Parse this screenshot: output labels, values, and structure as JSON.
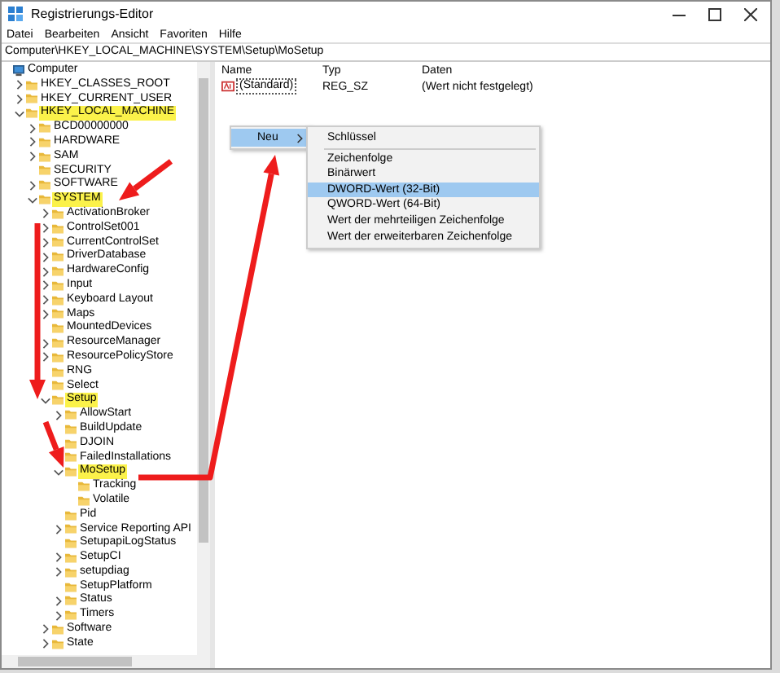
{
  "window": {
    "title": "Registrierungs-Editor"
  },
  "menu_bar": [
    "Datei",
    "Bearbeiten",
    "Ansicht",
    "Favoriten",
    "Hilfe"
  ],
  "address_bar": "Computer\\HKEY_LOCAL_MACHINE\\SYSTEM\\Setup\\MoSetup",
  "tree": [
    {
      "label": "Computer",
      "kind": "computer",
      "highlighted": false,
      "children": [
        {
          "label": "HKEY_CLASSES_ROOT",
          "kind": "folder",
          "highlighted": false,
          "expanded": false
        },
        {
          "label": "HKEY_CURRENT_USER",
          "kind": "folder",
          "highlighted": false,
          "expanded": false
        },
        {
          "label": "HKEY_LOCAL_MACHINE",
          "kind": "folder",
          "highlighted": true,
          "expanded": true,
          "children": [
            {
              "label": "BCD00000000",
              "kind": "folder",
              "highlighted": false,
              "expanded": false
            },
            {
              "label": "HARDWARE",
              "kind": "folder",
              "highlighted": false,
              "expanded": false
            },
            {
              "label": "SAM",
              "kind": "folder",
              "highlighted": false,
              "expanded": false
            },
            {
              "label": "SECURITY",
              "kind": "folder",
              "highlighted": false
            },
            {
              "label": "SOFTWARE",
              "kind": "folder",
              "highlighted": false,
              "expanded": false
            },
            {
              "label": "SYSTEM",
              "kind": "folder",
              "highlighted": true,
              "expanded": true,
              "children": [
                {
                  "label": "ActivationBroker",
                  "kind": "folder",
                  "highlighted": false,
                  "expanded": false
                },
                {
                  "label": "ControlSet001",
                  "kind": "folder",
                  "highlighted": false,
                  "expanded": false
                },
                {
                  "label": "CurrentControlSet",
                  "kind": "folder",
                  "highlighted": false,
                  "expanded": false
                },
                {
                  "label": "DriverDatabase",
                  "kind": "folder",
                  "highlighted": false,
                  "expanded": false
                },
                {
                  "label": "HardwareConfig",
                  "kind": "folder",
                  "highlighted": false,
                  "expanded": false
                },
                {
                  "label": "Input",
                  "kind": "folder",
                  "highlighted": false,
                  "expanded": false
                },
                {
                  "label": "Keyboard Layout",
                  "kind": "folder",
                  "highlighted": false,
                  "expanded": false
                },
                {
                  "label": "Maps",
                  "kind": "folder",
                  "highlighted": false,
                  "expanded": false
                },
                {
                  "label": "MountedDevices",
                  "kind": "folder",
                  "highlighted": false
                },
                {
                  "label": "ResourceManager",
                  "kind": "folder",
                  "highlighted": false,
                  "expanded": false
                },
                {
                  "label": "ResourcePolicyStore",
                  "kind": "folder",
                  "highlighted": false,
                  "expanded": false
                },
                {
                  "label": "RNG",
                  "kind": "folder",
                  "highlighted": false
                },
                {
                  "label": "Select",
                  "kind": "folder",
                  "highlighted": false
                },
                {
                  "label": "Setup",
                  "kind": "folder",
                  "highlighted": true,
                  "expanded": true,
                  "children": [
                    {
                      "label": "AllowStart",
                      "kind": "folder",
                      "highlighted": false,
                      "expanded": false
                    },
                    {
                      "label": "BuildUpdate",
                      "kind": "folder",
                      "highlighted": false
                    },
                    {
                      "label": "DJOIN",
                      "kind": "folder",
                      "highlighted": false
                    },
                    {
                      "label": "FailedInstallations",
                      "kind": "folder",
                      "highlighted": false
                    },
                    {
                      "label": "MoSetup",
                      "kind": "folder",
                      "highlighted": true,
                      "expanded": true,
                      "children": [
                        {
                          "label": "Tracking",
                          "kind": "folder",
                          "highlighted": false
                        },
                        {
                          "label": "Volatile",
                          "kind": "folder",
                          "highlighted": false
                        }
                      ]
                    },
                    {
                      "label": "Pid",
                      "kind": "folder",
                      "highlighted": false
                    },
                    {
                      "label": "Service Reporting API",
                      "kind": "folder",
                      "highlighted": false,
                      "expanded": false
                    },
                    {
                      "label": "SetupapiLogStatus",
                      "kind": "folder",
                      "highlighted": false
                    },
                    {
                      "label": "SetupCI",
                      "kind": "folder",
                      "highlighted": false,
                      "expanded": false
                    },
                    {
                      "label": "setupdiag",
                      "kind": "folder",
                      "highlighted": false,
                      "expanded": false
                    },
                    {
                      "label": "SetupPlatform",
                      "kind": "folder",
                      "highlighted": false
                    },
                    {
                      "label": "Status",
                      "kind": "folder",
                      "highlighted": false,
                      "expanded": false
                    },
                    {
                      "label": "Timers",
                      "kind": "folder",
                      "highlighted": false,
                      "expanded": false
                    }
                  ]
                },
                {
                  "label": "Software",
                  "kind": "folder",
                  "highlighted": false,
                  "expanded": false
                },
                {
                  "label": "State",
                  "kind": "folder",
                  "highlighted": false,
                  "expanded": false
                }
              ]
            }
          ]
        }
      ]
    }
  ],
  "values_table": {
    "columns": [
      "Name",
      "Typ",
      "Daten"
    ],
    "rows": [
      {
        "name": "(Standard)",
        "type": "REG_SZ",
        "data": "(Wert nicht festgelegt)"
      }
    ]
  },
  "context_menu": {
    "items": [
      {
        "label": "Neu",
        "selected": true
      }
    ]
  },
  "submenu": {
    "items": [
      {
        "kind": "item",
        "label": "Schlüssel",
        "selected": false
      },
      {
        "kind": "separator"
      },
      {
        "kind": "item",
        "label": "Zeichenfolge",
        "selected": false
      },
      {
        "kind": "item",
        "label": "Binärwert",
        "selected": false
      },
      {
        "kind": "item",
        "label": "DWORD-Wert (32-Bit)",
        "selected": true
      },
      {
        "kind": "item",
        "label": "QWORD-Wert (64-Bit)",
        "selected": false
      },
      {
        "kind": "item",
        "label": "Wert der mehrteiligen Zeichenfolge",
        "selected": false
      },
      {
        "kind": "item",
        "label": "Wert der erweiterbaren Zeichenfolge",
        "selected": false
      }
    ]
  }
}
